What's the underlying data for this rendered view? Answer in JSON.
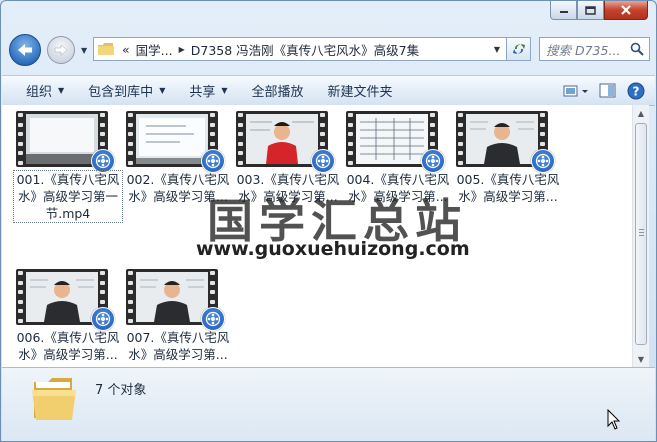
{
  "window": {
    "caption_buttons": [
      "minimize-icon",
      "maximize-icon",
      "close-icon"
    ]
  },
  "address": {
    "overflow": "«",
    "segments": [
      "国学...",
      "D7358 冯浩刚《真传八宅风水》高级7集"
    ],
    "search_placeholder": "搜索 D735..."
  },
  "toolbar": {
    "items": [
      {
        "label": "组织",
        "has_dropdown": true
      },
      {
        "label": "包含到库中",
        "has_dropdown": true
      },
      {
        "label": "共享",
        "has_dropdown": true
      },
      {
        "label": "全部播放",
        "has_dropdown": false
      },
      {
        "label": "新建文件夹",
        "has_dropdown": false
      }
    ],
    "right_icons": [
      "view-options-icon",
      "preview-pane-icon",
      "help-icon"
    ]
  },
  "files": [
    {
      "name": "001.《真传八宅风水》高级学习第一节.mp4",
      "scene": "whiteboard",
      "selected": true
    },
    {
      "name": "002.《真传八宅风水》高级学习第...",
      "scene": "whiteboard-lines",
      "selected": false
    },
    {
      "name": "003.《真传八宅风水》高级学习第...",
      "scene": "speaker-red",
      "selected": false
    },
    {
      "name": "004.《真传八宅风水》高级学习第...",
      "scene": "chart",
      "selected": false
    },
    {
      "name": "005.《真传八宅风水》高级学习第...",
      "scene": "speaker-dark",
      "selected": false
    },
    {
      "name": "006.《真传八宅风水》高级学习第...",
      "scene": "speaker-dark",
      "selected": false
    },
    {
      "name": "007.《真传八宅风水》高级学习第...",
      "scene": "speaker-dark",
      "selected": false
    }
  ],
  "watermark": {
    "title": "国学汇总站",
    "url": "www.guoxuehuizong.com"
  },
  "details": {
    "count_text": "7 个对象"
  },
  "colors": {
    "accent": "#2e6fbf",
    "close": "#c3432d",
    "media_badge": "#1f59b6"
  }
}
